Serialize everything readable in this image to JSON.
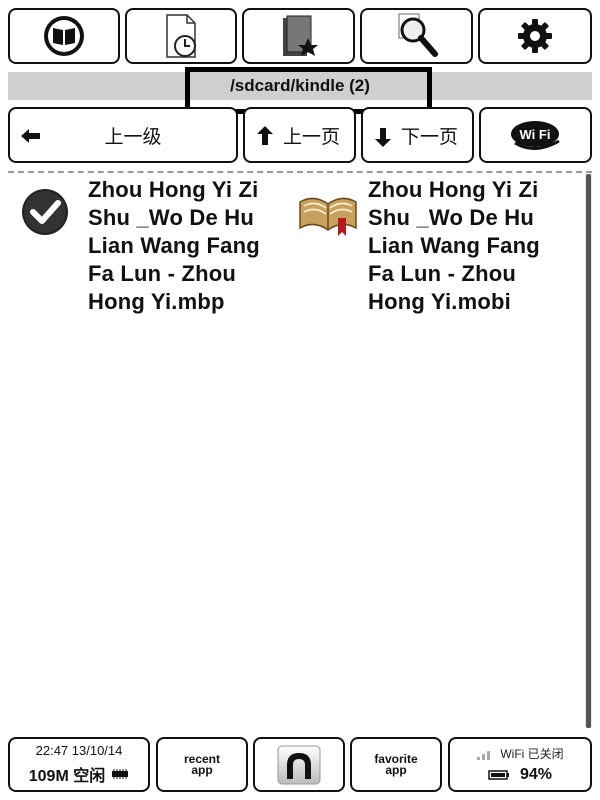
{
  "toolbar": {
    "icons": [
      "book-icon",
      "document-clock-icon",
      "favorites-folder-icon",
      "search-icon",
      "gear-icon"
    ]
  },
  "path_bar": {
    "path": "/sdcard/kindle (2)"
  },
  "nav": {
    "up_level": "上一级",
    "prev_page": "上一页",
    "next_page": "下一页",
    "wifi_label": "Wi Fi"
  },
  "files": [
    {
      "name": "Zhou Hong Yi Zi Shu _Wo De Hu Lian Wang Fang Fa Lun  - Zhou Hong Yi.mbp",
      "icon": "checkmark-icon"
    },
    {
      "name": "Zhou Hong Yi Zi Shu _Wo De Hu Lian Wang Fang Fa Lun  - Zhou Hong Yi.mobi",
      "icon": "open-book-icon"
    }
  ],
  "status": {
    "time": "22:47 13/10/14",
    "memory": "109M 空闲",
    "recent": [
      "recent",
      "app"
    ],
    "favorite": [
      "favorite",
      "app"
    ],
    "wifi_status": "WiFi 已关闭",
    "battery": "94%"
  }
}
